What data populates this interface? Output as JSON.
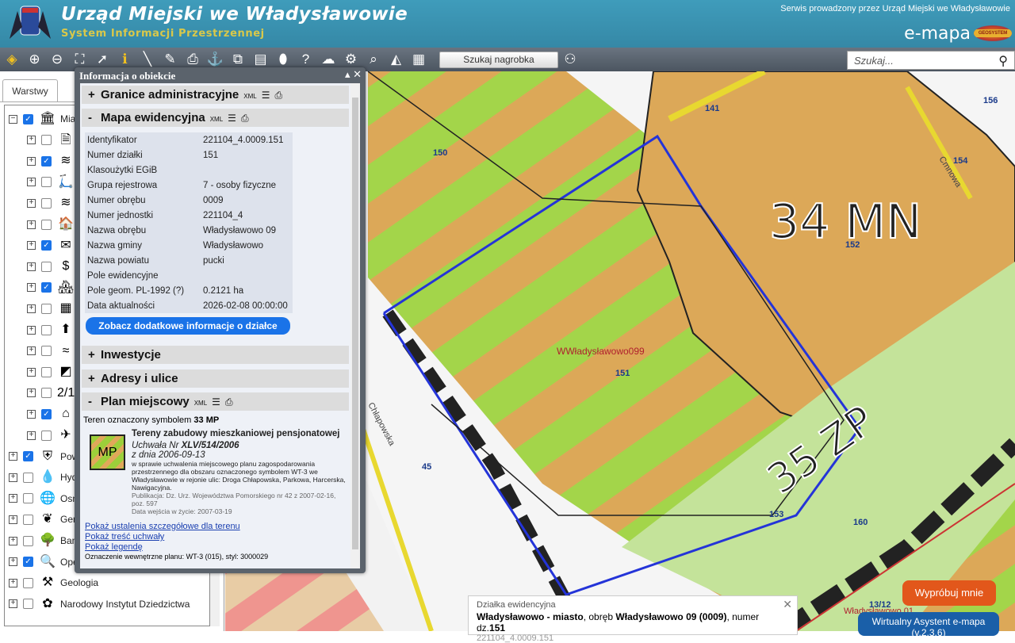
{
  "header": {
    "title": "Urząd Miejski we Władysławowie",
    "subtitle": "System Informacji Przestrzennej",
    "operator": "Serwis prowadzony przez Urząd Miejski we Władysławowie",
    "brand": "e-mapa",
    "brand_logo_text": "GEOSYSTEM"
  },
  "toolbar": {
    "tools": [
      "layers-icon",
      "zoom-in-icon",
      "zoom-out-icon",
      "full-extent-icon",
      "select-icon",
      "info-icon",
      "measure-distance-icon",
      "measure-area-icon",
      "print-icon",
      "locate-icon",
      "copy-icon",
      "layout-icon",
      "shape-icon",
      "help-icon",
      "cloud-icon",
      "settings-icon",
      "search-map-icon",
      "triangle-icon",
      "color-grid-icon"
    ],
    "nearby_label": "Szukaj nagrobka",
    "search_placeholder": "Szukaj..."
  },
  "left": {
    "tab": "Warstwy",
    "layers": [
      {
        "name": "Mias",
        "checked": true,
        "expanded": true,
        "icon": "🏛"
      },
      {
        "name": "",
        "checked": false,
        "icon": "🗎"
      },
      {
        "name": "",
        "checked": true,
        "icon": "≋"
      },
      {
        "name": "",
        "checked": false,
        "icon": "🛴"
      },
      {
        "name": "",
        "checked": false,
        "icon": "≋"
      },
      {
        "name": "",
        "checked": false,
        "icon": "🏠"
      },
      {
        "name": "",
        "checked": true,
        "icon": "✉"
      },
      {
        "name": "",
        "checked": false,
        "icon": "$"
      },
      {
        "name": "",
        "checked": true,
        "icon": "🏘"
      },
      {
        "name": "",
        "checked": false,
        "icon": "▦"
      },
      {
        "name": "",
        "checked": false,
        "icon": "⬆"
      },
      {
        "name": "",
        "checked": false,
        "icon": "≈"
      },
      {
        "name": "",
        "checked": false,
        "icon": "◩"
      },
      {
        "name": "",
        "checked": false,
        "icon": "2/18"
      },
      {
        "name": "",
        "checked": true,
        "icon": "⌂"
      },
      {
        "name": "",
        "checked": false,
        "icon": "✈"
      },
      {
        "name": "Pow",
        "checked": true,
        "icon": "⛨"
      },
      {
        "name": "Hyd",
        "checked": false,
        "icon": "💧"
      },
      {
        "name": "Osn wsp",
        "checked": false,
        "icon": "🌐"
      },
      {
        "name": "Gen Środ",
        "checked": false,
        "icon": "❦"
      },
      {
        "name": "Ban",
        "checked": false,
        "icon": "🌳"
      },
      {
        "name": "OpenStreetMap",
        "checked": true,
        "icon": "🔍"
      },
      {
        "name": "Geologia",
        "checked": false,
        "icon": "⚒"
      },
      {
        "name": "Narodowy Instytut Dziedzictwa",
        "checked": false,
        "icon": "✿"
      }
    ]
  },
  "panel": {
    "title": "Informacja o obiekcie",
    "xml": "XML",
    "sections": {
      "admin": "Granice administracyjne",
      "ewid": "Mapa ewidencyjna",
      "inwest": "Inwestycje",
      "adresy": "Adresy i ulice",
      "plan": "Plan miejscowy"
    },
    "rows": [
      {
        "k": "Identyfikator",
        "v": "221104_4.0009.151"
      },
      {
        "k": "Numer działki",
        "v": "151"
      },
      {
        "k": "Klasoużytki EGiB",
        "v": ""
      },
      {
        "k": "Grupa rejestrowa",
        "v": "7 - osoby fizyczne"
      },
      {
        "k": "Numer obrębu",
        "v": "0009"
      },
      {
        "k": "Numer jednostki",
        "v": "221104_4"
      },
      {
        "k": "Nazwa obrębu",
        "v": "Władysławowo 09"
      },
      {
        "k": "Nazwa gminy",
        "v": "Władysławowo"
      },
      {
        "k": "Nazwa powiatu",
        "v": "pucki"
      },
      {
        "k": "Pole ewidencyjne",
        "v": ""
      },
      {
        "k": "Pole geom. PL-1992 (?)",
        "v": "0.2121 ha"
      },
      {
        "k": "Data aktualności",
        "v": "2026-02-08 00:00:00"
      }
    ],
    "more_button": "Zobacz dodatkowe informacje o działce",
    "plan": {
      "symbol_text": "Teren oznaczony symbolem",
      "symbol": "33 MP",
      "badge": "MP",
      "name": "Tereny zabudowy mieszkaniowej pensjonatowej",
      "resolution_prefix": "Uchwała Nr",
      "resolution": "XLV/514/2006",
      "date": "z dnia 2006-09-13",
      "description": "w sprawie uchwalenia miejscowego planu zagospodarowania przestrzennego dla obszaru oznaczonego symbolem WT-3 we Władysławowie w rejonie ulic: Droga Chłapowska, Parkowa, Harcerska, Nawigacyjna.",
      "publication": "Publikacja: Dz. Urz. Województwa Pomorskiego nr 42 z 2007-02-16, poz. 597",
      "effective": "Data wejścia w życie: 2007-03-19",
      "links": [
        "Pokaż ustalenia szczegółowe dla terenu",
        "Pokaż treść uchwały",
        "Pokaż legendę"
      ],
      "internal": "Oznaczenie wewnętrzne planu: WT-3 (015), styl: 3000029"
    }
  },
  "map": {
    "labels": {
      "zone1": "34 MN",
      "zone2": "35 ZP",
      "p150": "150",
      "p141": "141",
      "p156": "156",
      "p154": "154",
      "p152": "152",
      "p151": "151",
      "p45": "45",
      "p153": "153",
      "p160": "160",
      "p1312": "13/12",
      "obreb": "WWładysławowo099",
      "obreb2": "Władysławowo 01",
      "street1": "Chłapowska",
      "street2": "Cmnowa"
    }
  },
  "popup": {
    "title": "Działka ewidencyjna",
    "line_a": "Władysławowo - miasto",
    "line_b": ", obręb ",
    "line_c": "Władysławowo 09 (0009)",
    "line_d": ", numer dz.",
    "line_e": "151",
    "id": "221104_4.0009.151"
  },
  "assistant": {
    "try": "Wypróbuj mnie",
    "name": "Wirtualny Asystent e-mapa",
    "version": "(v.2.3.6)"
  }
}
